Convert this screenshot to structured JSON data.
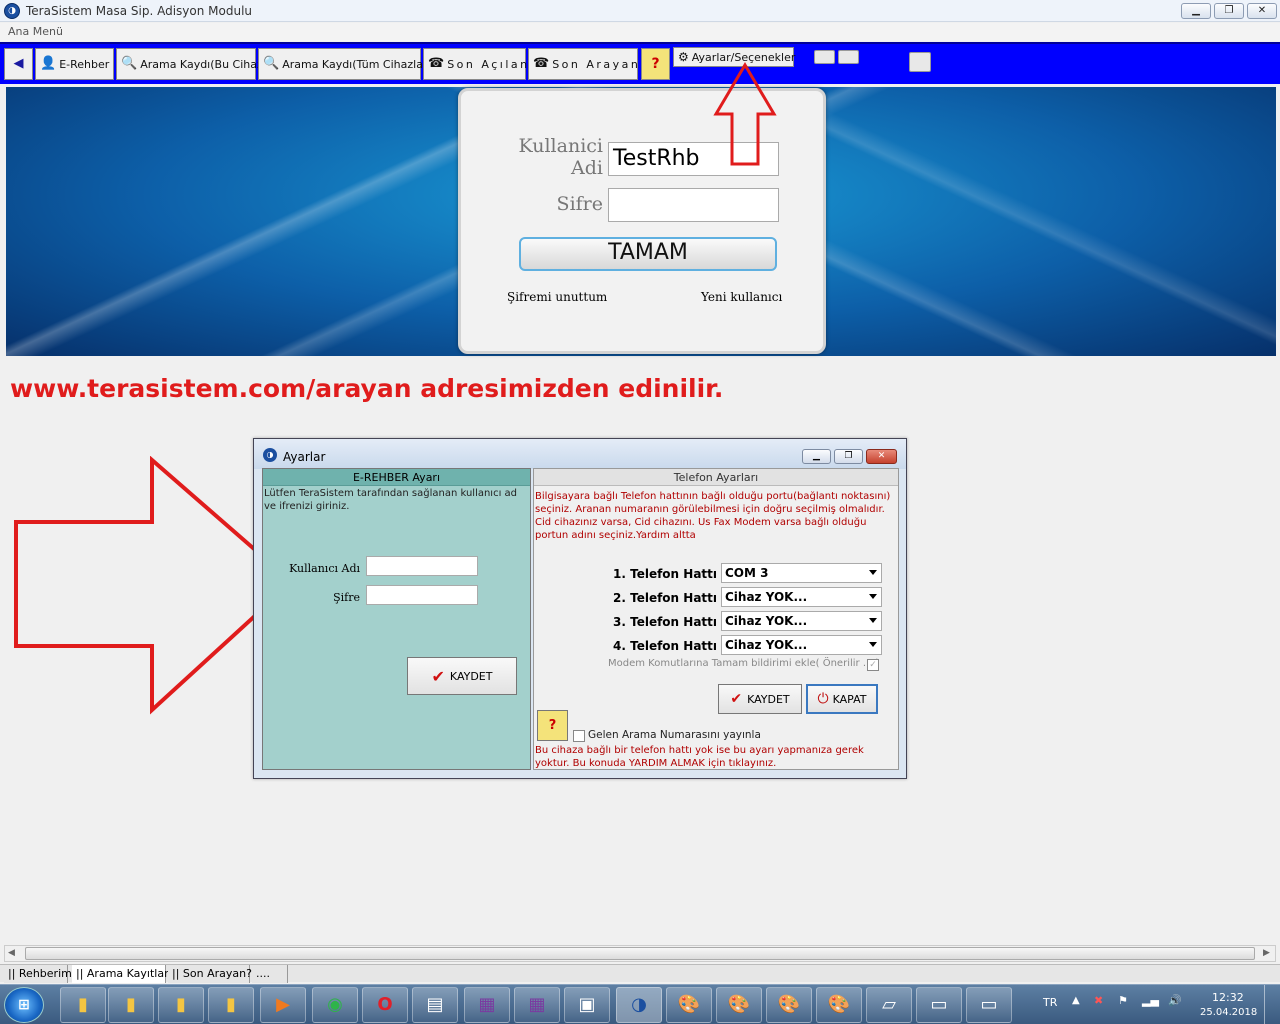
{
  "window": {
    "title": "TeraSistem Masa Sip. Adisyon Modulu",
    "menu": "Ana Menü"
  },
  "toolbar": {
    "erehber": "E-Rehber",
    "arama_bu": "Arama Kaydı(Bu Cihaz)",
    "arama_tum": "Arama Kaydı(Tüm Cihazlar)",
    "son_acilan": "Son Açılan",
    "son_arayan": "Son Arayan",
    "help": "?",
    "ayarlar": "Ayarlar/Seçenekler"
  },
  "login": {
    "user_label_1": "Kullanici",
    "user_label_2": "Adi",
    "user_value": "TestRhb",
    "pass_label": "Sifre",
    "ok": "TAMAM",
    "forgot": "Şifremi unuttum",
    "new_user": "Yeni kullanıcı"
  },
  "website_text": "www.terasistem.com/arayan adresimizden edinilir.",
  "dialog": {
    "title": "Ayarlar",
    "left": {
      "header": "E-REHBER Ayarı",
      "desc": "Lütfen TeraSistem tarafından sağlanan kullanıcı ad ve ifrenizi giriniz.",
      "user_label": "Kullanıcı Adı",
      "pass_label": "Şifre",
      "save": "KAYDET"
    },
    "right": {
      "header": "Telefon Ayarları",
      "desc": "Bilgisayara bağlı Telefon hattının bağlı olduğu portu(bağlantı noktasını) seçiniz. Aranan numaranın görülebilmesi için doğru seçilmiş olmalıdır. Cid cihazınız varsa, Cid cihazını. Us Fax Modem varsa bağlı olduğu portun adını seçiniz.Yardım altta",
      "lines": [
        {
          "label": "1. Telefon Hattı",
          "value": "COM 3"
        },
        {
          "label": "2. Telefon Hattı",
          "value": "Cihaz YOK..."
        },
        {
          "label": "3. Telefon Hattı",
          "value": "Cihaz YOK..."
        },
        {
          "label": "4. Telefon Hattı",
          "value": "Cihaz YOK..."
        }
      ],
      "modem_option": "Modem Komutlarına Tamam bildirimi ekle( Önerilir ... )",
      "save": "KAYDET",
      "close": "KAPAT",
      "help": "?",
      "publish": "Gelen Arama Numarasını yayınla",
      "footer": "Bu cihaza bağlı bir telefon hattı yok ise bu ayarı yapmanıza gerek yoktur. Bu konuda YARDIM ALMAK için tıklayınız."
    }
  },
  "tabs": [
    "|| Rehberim",
    "|| Arama Kayıtları",
    "|| Son Arayan?",
    "...."
  ],
  "tray": {
    "lang": "TR",
    "time": "12:32",
    "date": "25.04.2018"
  },
  "colors": {
    "toolbar": "#0000ff",
    "annotation": "#e01c1c",
    "left_pane": "#a3d0cc"
  }
}
